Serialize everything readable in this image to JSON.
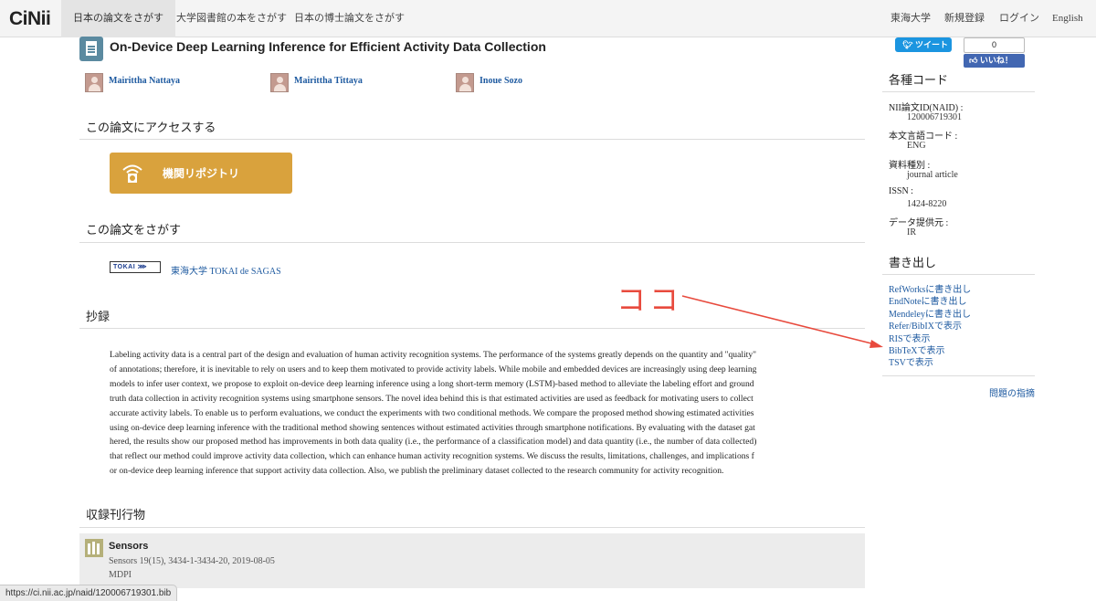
{
  "nav": {
    "logo": "CiNii",
    "tabs": [
      "日本の論文をさがす",
      "大学図書館の本をさがす",
      "日本の博士論文をさがす"
    ],
    "right": [
      "東海大学",
      "新規登録",
      "ログイン",
      "English"
    ]
  },
  "paper": {
    "title": "On-Device Deep Learning Inference for Efficient Activity Data Collection",
    "authors": [
      "Mairittha Nattaya",
      "Mairittha Tittaya",
      "Inoue Sozo"
    ]
  },
  "access": {
    "heading": "この論文にアクセスする",
    "repository_button": "機関リポジトリ"
  },
  "search": {
    "heading": "この論文をさがす",
    "logo_text": "TOKAI ⋙",
    "link": "東海大学 TOKAI de SAGAS"
  },
  "abstract": {
    "heading": "抄録",
    "lines": [
      "Labeling activity data is a central part of the design and evaluation of human activity recognition systems. The performance of the systems greatly depends on the quantity and \"quality\"",
      "of annotations; therefore, it is inevitable to rely on users and to keep them motivated to provide activity labels. While mobile and embedded devices are increasingly using deep learning",
      "models to infer user context, we propose to exploit on-device deep learning inference using a long short-term memory (LSTM)-based method to alleviate the labeling effort and ground",
      "truth data collection in activity recognition systems using smartphone sensors. The novel idea behind this is that estimated activities are used as feedback for motivating users to collect",
      "accurate activity labels. To enable us to perform evaluations, we conduct the experiments with two conditional methods. We compare the proposed method showing estimated activities",
      "using on-device deep learning inference with the traditional method showing sentences without estimated activities through smartphone notifications. By evaluating with the dataset gat",
      "hered, the results show our proposed method has improvements in both data quality (i.e., the performance of a classification model) and data quantity (i.e., the number of data collected)",
      "that reflect our method could improve activity data collection, which can enhance human activity recognition systems. We discuss the results, limitations, challenges, and implications f",
      "or on-device deep learning inference that support activity data collection. Also, we publish the preliminary dataset collected to the research community for activity recognition."
    ]
  },
  "journal": {
    "heading": "収録刊行物",
    "name": "Sensors",
    "citation": "Sensors 19(15), 3434-1-3434-20, 2019-08-05",
    "publisher": "MDPI"
  },
  "status_url": "https://ci.nii.ac.jp/naid/120006719301.bib",
  "social": {
    "tweet": "ツイート",
    "like_count": "0",
    "like": "いいね！"
  },
  "codes": {
    "heading": "各種コード",
    "items": [
      {
        "label": "NII論文ID(NAID) :",
        "value": "120006719301"
      },
      {
        "label": "本文言語コード :",
        "value": "ENG"
      },
      {
        "label": "資料種別 :",
        "value": "journal article"
      },
      {
        "label": "ISSN :",
        "value": "1424-8220"
      },
      {
        "label": "データ提供元 :",
        "value": "IR"
      }
    ]
  },
  "export": {
    "heading": "書き出し",
    "links": [
      "RefWorksに書き出し",
      "EndNoteに書き出し",
      "Mendeleyに書き出し",
      "Refer/BibIXで表示",
      "RISで表示",
      "BibTeXで表示",
      "TSVで表示"
    ]
  },
  "report_link": "問題の指摘",
  "annotation": {
    "text": "ココ",
    "color": "#e84a3d"
  }
}
